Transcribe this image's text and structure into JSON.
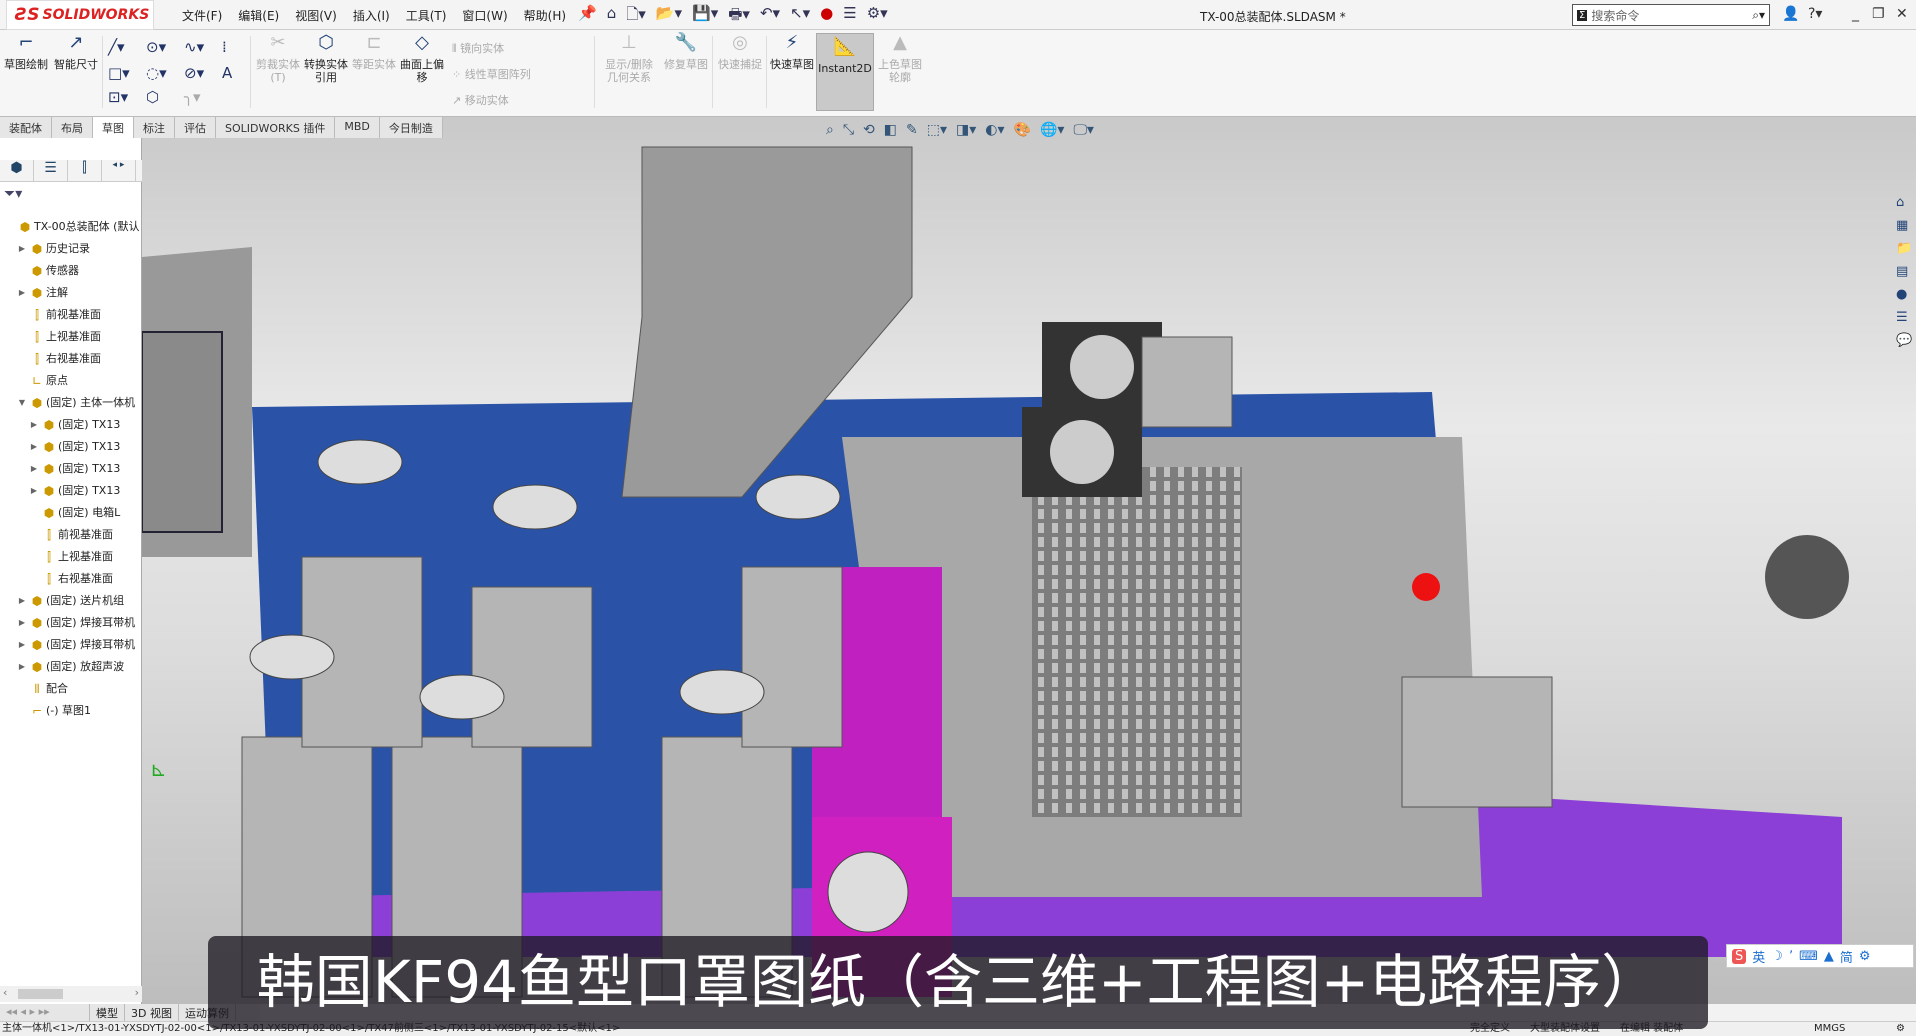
{
  "app": {
    "logo": "SOLIDWORKS",
    "document_title": "TX-00总装配体.SLDASM *"
  },
  "menu": [
    "文件(F)",
    "编辑(E)",
    "视图(V)",
    "插入(I)",
    "工具(T)",
    "窗口(W)",
    "帮助(H)"
  ],
  "search": {
    "placeholder": "搜索命令"
  },
  "ribbon": {
    "sketch": "草图绘制",
    "smart_dim": "智能尺寸",
    "trim": "剪裁实体(T)",
    "convert": "转换实体引用",
    "offset": "等距实体",
    "surface_offset": "曲面上偏移",
    "mirror": "镜向实体",
    "linear_pattern": "线性草图阵列",
    "move": "移动实体",
    "show_relations": "显示/删除几何关系",
    "repair": "修复草图",
    "quick_snap": "快速捕捉",
    "rapid_sketch": "快速草图",
    "instant2d": "Instant2D",
    "shaded_sketch": "上色草图轮廓"
  },
  "tabs": [
    "装配体",
    "布局",
    "草图",
    "标注",
    "评估",
    "SOLIDWORKS 插件",
    "MBD",
    "今日制造"
  ],
  "active_tab": "草图",
  "tree": [
    {
      "label": "TX-00总装配体 (默认",
      "level": 0,
      "arrow": ""
    },
    {
      "label": "历史记录",
      "level": 1,
      "arrow": "▶"
    },
    {
      "label": "传感器",
      "level": 1,
      "arrow": ""
    },
    {
      "label": "注解",
      "level": 1,
      "arrow": "▶"
    },
    {
      "label": "前视基准面",
      "level": 1,
      "arrow": ""
    },
    {
      "label": "上视基准面",
      "level": 1,
      "arrow": ""
    },
    {
      "label": "右视基准面",
      "level": 1,
      "arrow": ""
    },
    {
      "label": "原点",
      "level": 1,
      "arrow": ""
    },
    {
      "label": "(固定) 主体一体机",
      "level": 1,
      "arrow": "▼"
    },
    {
      "label": "(固定) TX13",
      "level": 2,
      "arrow": "▶"
    },
    {
      "label": "(固定) TX13",
      "level": 2,
      "arrow": "▶"
    },
    {
      "label": "(固定) TX13",
      "level": 2,
      "arrow": "▶"
    },
    {
      "label": "(固定) TX13",
      "level": 2,
      "arrow": "▶"
    },
    {
      "label": "(固定) 电箱L",
      "level": 2,
      "arrow": ""
    },
    {
      "label": "前视基准面",
      "level": 2,
      "arrow": ""
    },
    {
      "label": "上视基准面",
      "level": 2,
      "arrow": ""
    },
    {
      "label": "右视基准面",
      "level": 2,
      "arrow": ""
    },
    {
      "label": "(固定) 送片机组",
      "level": 1,
      "arrow": "▶"
    },
    {
      "label": "(固定) 焊接耳带机",
      "level": 1,
      "arrow": "▶"
    },
    {
      "label": "(固定) 焊接耳带机",
      "level": 1,
      "arrow": "▶"
    },
    {
      "label": "(固定) 放超声波",
      "level": 1,
      "arrow": "▶"
    },
    {
      "label": "配合",
      "level": 1,
      "arrow": ""
    },
    {
      "label": "(-) 草图1",
      "level": 1,
      "arrow": ""
    }
  ],
  "bottom_tabs": [
    "模型",
    "3D 视图",
    "运动算例"
  ],
  "status": {
    "path": "主体一体机<1>/TX13-01-YXSDYTJ-02-00<1>/TX13-01-YXSDYTJ-02-00<1>/TX47前侧三<1>/TX13-01-YXSDYTJ-02-15<默认<1>",
    "defined": "完全定义",
    "large_assembly": "大型装配体设置",
    "editing": "在编辑 装配体",
    "units": "MMGS"
  },
  "subtitle": "韩国KF94鱼型口罩图纸（含三维+工程图+电路程序）",
  "ime": {
    "lang": "英",
    "simplified": "简"
  }
}
